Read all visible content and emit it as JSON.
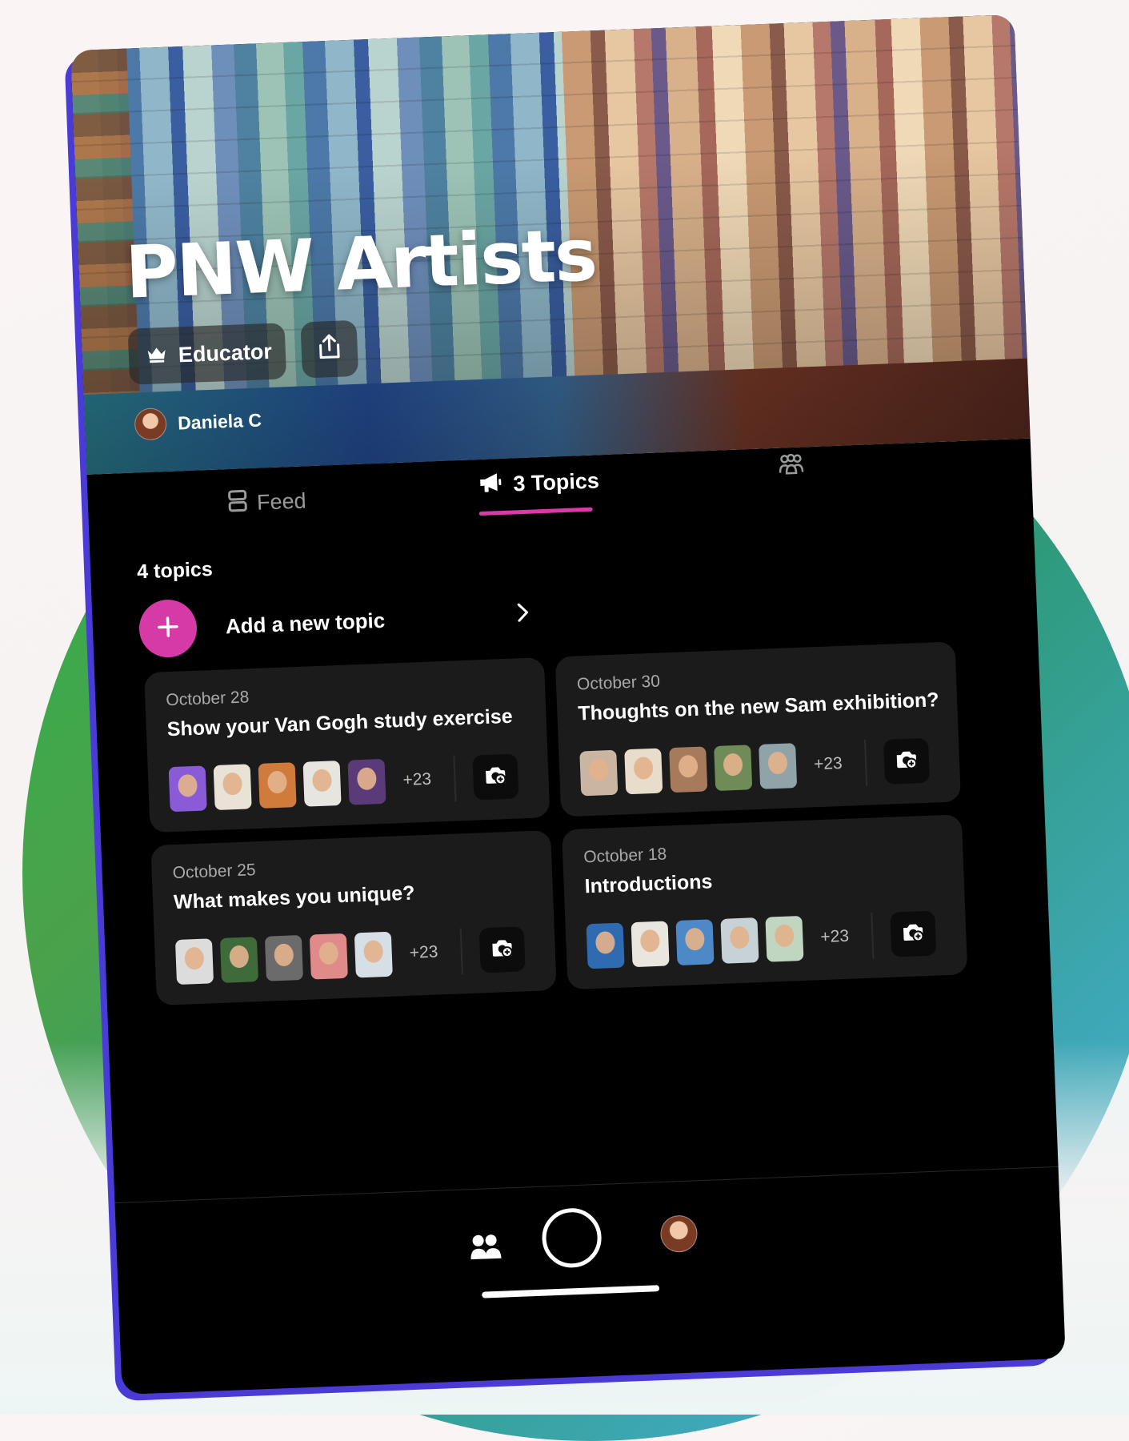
{
  "group": {
    "title": "PNW Artists",
    "role_badge": "Educator",
    "author": "Daniela C"
  },
  "tabs": {
    "feed": "Feed",
    "topics": "3 Topics",
    "members_icon": "people-group-icon"
  },
  "topics_section": {
    "count_label": "4 topics",
    "add_label": "Add a new topic"
  },
  "topics": [
    {
      "date": "October 28",
      "title": "Show your Van Gogh study exercise",
      "more": "+23",
      "avatars": [
        "#8a5bd6",
        "#e9e2d7",
        "#d07a3c",
        "#e7e5df",
        "#5b3a7a"
      ]
    },
    {
      "date": "October 30",
      "title": "Thoughts on the new Sam exhibition?",
      "more": "+23",
      "avatars": [
        "#c9b5a2",
        "#e8dccb",
        "#a87a5c",
        "#6f8b58",
        "#8fa3a8"
      ]
    },
    {
      "date": "October 25",
      "title": "What makes you unique?",
      "more": "+23",
      "avatars": [
        "#dcdcdc",
        "#3f6a3a",
        "#6b6b6b",
        "#e08a8a",
        "#d6dfe6"
      ]
    },
    {
      "date": "October 18",
      "title": "Introductions",
      "more": "+23",
      "avatars": [
        "#2f6bb0",
        "#e9e5df",
        "#4d89c7",
        "#c7d2d6",
        "#c1d6c1"
      ]
    }
  ],
  "colors": {
    "accent": "#d63aa7",
    "tablet_edge": "#4a3bd6",
    "card_bg": "#1b1b1b"
  }
}
